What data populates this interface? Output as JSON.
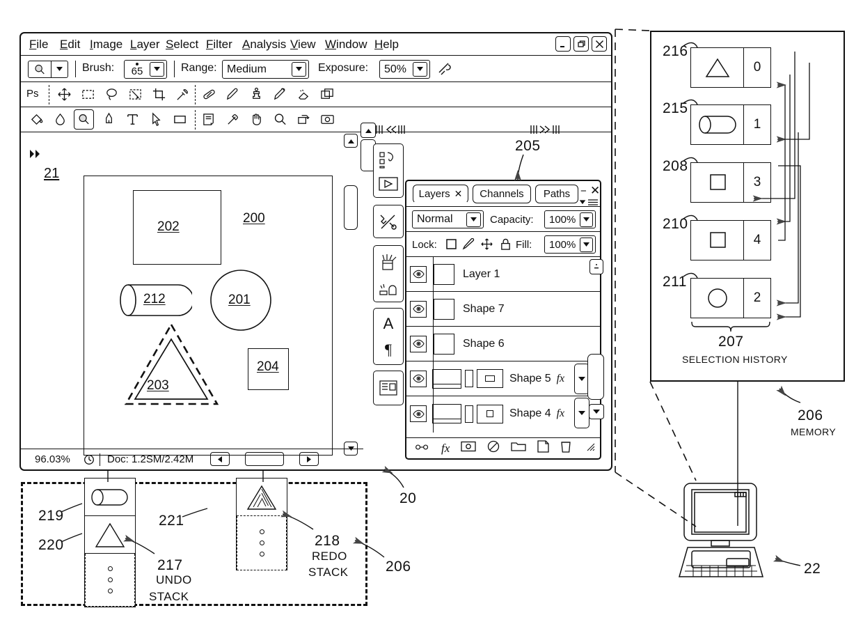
{
  "figure": {
    "refs": {
      "app_window": "20",
      "canvas": "21",
      "computer": "22",
      "document": "200",
      "circle": "201",
      "square_top": "202",
      "triangle": "203",
      "square_bottom": "204",
      "panel": "205",
      "memory": "206",
      "selection_history": "207",
      "entry_208": "208",
      "entry_210": "210",
      "entry_211": "211",
      "capsule": "212",
      "entry_215": "215",
      "entry_216": "216",
      "undo_stack": "217",
      "redo_stack": "218",
      "undo_item_top": "219",
      "undo_item_second": "220",
      "redo_item_top": "221"
    },
    "labels": {
      "memory": "MEMORY",
      "selection_history": "SELECTION HISTORY",
      "undo_stack_line1": "UNDO",
      "undo_stack_line2": "STACK",
      "redo_stack_line1": "REDO",
      "redo_stack_line2": "STACK"
    }
  },
  "app": {
    "menubar": {
      "items": [
        {
          "label": "File",
          "mnemonic": "F"
        },
        {
          "label": "Edit",
          "mnemonic": "E"
        },
        {
          "label": "Image",
          "mnemonic": "I"
        },
        {
          "label": "Layer",
          "mnemonic": "L"
        },
        {
          "label": "Select",
          "mnemonic": "S"
        },
        {
          "label": "Filter",
          "mnemonic": "F"
        },
        {
          "label": "Analysis",
          "mnemonic": "A"
        },
        {
          "label": "View",
          "mnemonic": "V"
        },
        {
          "label": "Window",
          "mnemonic": "W"
        },
        {
          "label": "Help",
          "mnemonic": "H"
        }
      ],
      "window_buttons": [
        "minimize",
        "restore",
        "close"
      ]
    },
    "options_bar": {
      "tool_preset_icon": "burn-tool-icon",
      "brush_label": "Brush:",
      "brush_value": "65",
      "range_label": "Range:",
      "range_value": "Medium",
      "exposure_label": "Exposure:",
      "exposure_value": "50%",
      "airbrush_icon": "airbrush-toggle-icon"
    },
    "toolbar_row1": {
      "logo": "Ps",
      "tools": [
        "move-tool-icon",
        "rectangular-marquee-icon",
        "lasso-icon",
        "quick-selection-icon",
        "crop-tool-icon",
        "eyedropper-icon",
        "healing-brush-icon",
        "brush-tool-icon",
        "clone-stamp-icon",
        "history-brush-icon",
        "eraser-tool-icon",
        "duplicate-layer-icon"
      ]
    },
    "toolbar_row2": {
      "tools": [
        "paint-bucket-icon",
        "blur-tool-icon",
        "burn-tool-icon",
        "pen-tool-icon",
        "type-tool-icon",
        "path-selection-icon",
        "rectangle-shape-icon",
        "notes-tool-icon",
        "eyedropper-alt-icon",
        "hand-tool-icon",
        "zoom-tool-icon",
        "rotate-view-icon",
        "camera-raw-icon"
      ],
      "selected_index": 2
    },
    "statusbar": {
      "zoom": "96.03%",
      "clock_icon": "clock-icon",
      "doc_label": "Doc: 1.2SM/2.42M",
      "scroll_left_icon": "triangle-left-icon",
      "scroll_right_icon": "triangle-right-icon"
    },
    "dock": {
      "scroll_up_icon": "triangle-up-icon",
      "collapse_left_icon": "double-chevron-left-icon",
      "collapse_right_icon": "double-chevron-right-icon",
      "buttons": [
        "color-swatches-icon",
        "tools-presets-icon",
        "brushes-icon",
        "character-paragraph-icon",
        "layer-comps-icon"
      ]
    },
    "canvas": {
      "shapes": [
        {
          "ref": "202",
          "kind": "square"
        },
        {
          "ref": "200",
          "kind": "document-label"
        },
        {
          "ref": "212",
          "kind": "capsule"
        },
        {
          "ref": "201",
          "kind": "circle"
        },
        {
          "ref": "203",
          "kind": "triangle-selected"
        },
        {
          "ref": "204",
          "kind": "square"
        }
      ]
    }
  },
  "layers_panel": {
    "tabs": [
      {
        "label": "Layers",
        "closable": true,
        "active": true
      },
      {
        "label": "Channels",
        "closable": false,
        "active": false
      },
      {
        "label": "Paths",
        "closable": false,
        "active": false
      }
    ],
    "panel_minimize_icon": "minimize-icon",
    "panel_close_icon": "close-icon",
    "panel_menu_icon": "panel-menu-icon",
    "blend_mode": "Normal",
    "capacity_label": "Capacity:",
    "capacity_value": "100%",
    "lock_label": "Lock:",
    "lock_icons": [
      "lock-transparent-icon",
      "lock-image-icon",
      "lock-position-icon",
      "lock-all-icon"
    ],
    "fill_label": "Fill:",
    "fill_value": "100%",
    "rows": [
      {
        "name": "Layer 1",
        "visible": true,
        "has_fx": false,
        "extra_thumbs": 0
      },
      {
        "name": "Shape 7",
        "visible": true,
        "has_fx": false,
        "extra_thumbs": 0
      },
      {
        "name": "Shape 6",
        "visible": true,
        "has_fx": false,
        "extra_thumbs": 0
      },
      {
        "name": "Shape 5",
        "visible": true,
        "has_fx": true,
        "fx_label": "fx",
        "extra_thumbs": 2
      },
      {
        "name": "Shape 4",
        "visible": true,
        "has_fx": true,
        "fx_label": "fx",
        "extra_thumbs": 2
      }
    ],
    "footer_icons": [
      "link-layers-icon",
      "add-layer-style-icon",
      "add-layer-mask-icon",
      "adjustment-layer-icon",
      "new-group-icon",
      "new-layer-icon",
      "delete-layer-icon"
    ],
    "scroll_up_icon": "scroll-up-icon",
    "scroll_down_icon": "scroll-down-icon"
  },
  "memory": {
    "entries": [
      {
        "ref": "216",
        "shape": "triangle",
        "index": "0"
      },
      {
        "ref": "215",
        "shape": "capsule",
        "index": "1"
      },
      {
        "ref": "208",
        "shape": "square",
        "index": "3"
      },
      {
        "ref": "210",
        "shape": "square",
        "index": "4"
      },
      {
        "ref": "211",
        "shape": "circle",
        "index": "2"
      }
    ]
  },
  "undo_stack": {
    "items": [
      {
        "ref": "219",
        "shape": "capsule"
      },
      {
        "ref": "220",
        "shape": "triangle"
      }
    ],
    "ellipsis_dots": 3
  },
  "redo_stack": {
    "items": [
      {
        "ref": "221",
        "shape": "triangle-hatched"
      }
    ],
    "ellipsis_dots": 3
  },
  "colors": {
    "ink": "#111111",
    "paper": "#ffffff"
  }
}
